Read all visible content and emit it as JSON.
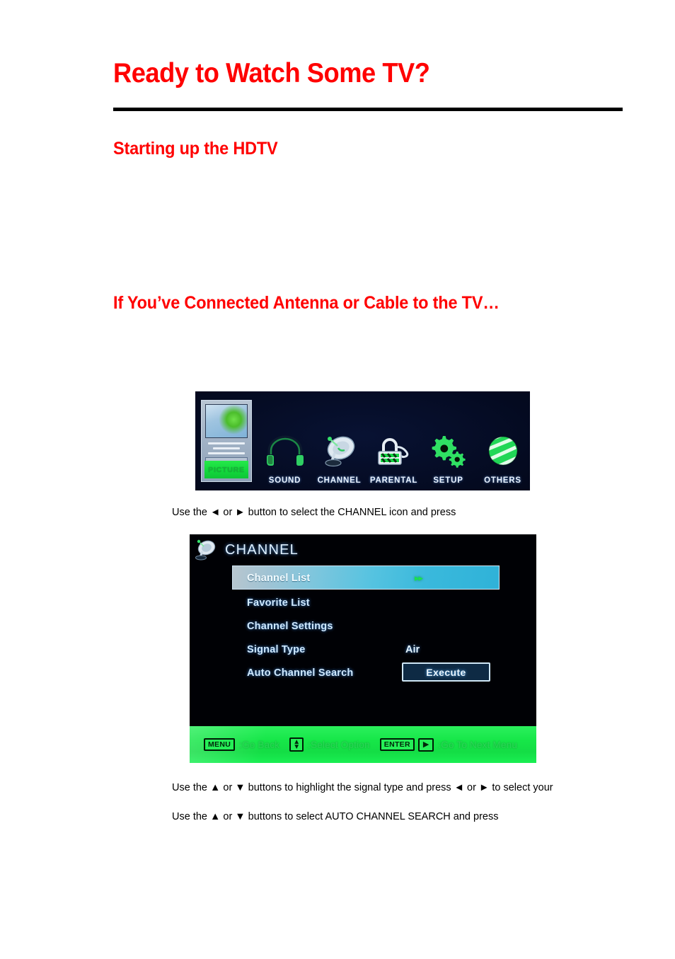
{
  "document": {
    "title": "Ready to Watch Some TV?",
    "sections": [
      {
        "heading": "Starting up the HDTV"
      },
      {
        "heading": "If You’ve Connected Antenna or Cable to the TV…"
      }
    ],
    "captions": {
      "select_channel_icon": "Use the ◄ or ► button to select the CHANNEL icon and press",
      "highlight_signal_type": "Use the ▲ or ▼ buttons to highlight the signal type and press ◄ or ► to select your",
      "select_auto_channel_search": "Use the ▲ or ▼ buttons to select AUTO CHANNEL SEARCH and press"
    },
    "colors": {
      "heading_red": "#ff0000",
      "rule_black": "#000000",
      "osd_green": "#14dd45",
      "osd_highlight_cyan": "#3ab9dc",
      "osd_text_blue": "#cfe9ff"
    }
  },
  "osd_main_menu": {
    "items": [
      {
        "label": "PICTURE",
        "icon": "picture-icon",
        "selected": true
      },
      {
        "label": "SOUND",
        "icon": "headphones-icon",
        "selected": false
      },
      {
        "label": "CHANNEL",
        "icon": "satellite-dish-icon",
        "selected": false
      },
      {
        "label": "PARENTAL",
        "icon": "padlock-icon",
        "selected": false
      },
      {
        "label": "SETUP",
        "icon": "gears-icon",
        "selected": false
      },
      {
        "label": "OTHERS",
        "icon": "globe-icon",
        "selected": false
      }
    ]
  },
  "osd_channel_menu": {
    "title": "CHANNEL",
    "title_icon": "satellite-dish-icon",
    "rows": [
      {
        "label": "Channel List",
        "value": "",
        "selected": true,
        "arrows": "▸▸"
      },
      {
        "label": "Favorite List",
        "value": "",
        "selected": false
      },
      {
        "label": "Channel Settings",
        "value": "",
        "selected": false
      },
      {
        "label": "Signal Type",
        "value": "Air",
        "selected": false
      },
      {
        "label": "Auto Channel Search",
        "value": "",
        "selected": false,
        "button": "Execute"
      }
    ],
    "footer": {
      "menu_key": "MENU",
      "menu_hint": ":Go Back",
      "updown_hint": ":Select Option",
      "enter_key": "ENTER",
      "enter_hint": ":Go To Next Menu"
    }
  }
}
